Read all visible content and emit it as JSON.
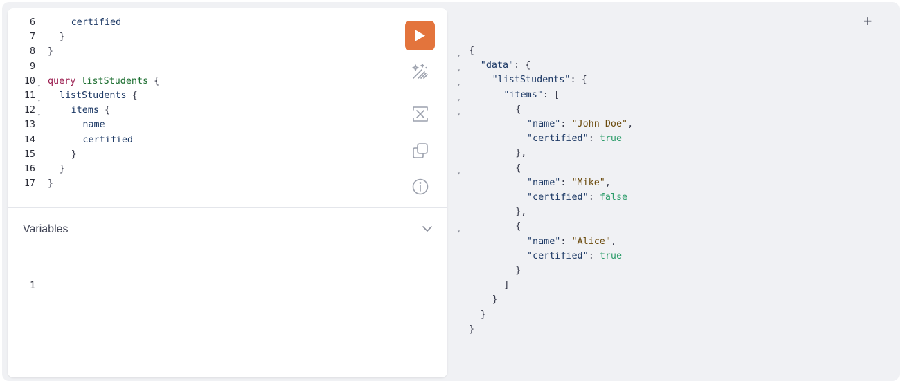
{
  "editor": {
    "lines": [
      {
        "n": "6",
        "tokens": [
          {
            "t": "certified",
            "c": "fld"
          }
        ],
        "indent": 4
      },
      {
        "n": "7",
        "tokens": [
          {
            "t": "}",
            "c": "pun"
          }
        ],
        "indent": 2
      },
      {
        "n": "8",
        "tokens": [
          {
            "t": "}",
            "c": "pun"
          }
        ],
        "indent": 0
      },
      {
        "n": "9",
        "tokens": [],
        "indent": 0
      },
      {
        "n": "10",
        "fold": true,
        "tokens": [
          {
            "t": "query",
            "c": "kw"
          },
          {
            "t": " ",
            "c": "pun"
          },
          {
            "t": "listStudents",
            "c": "def"
          },
          {
            "t": " {",
            "c": "pun"
          }
        ],
        "indent": 0
      },
      {
        "n": "11",
        "fold": true,
        "tokens": [
          {
            "t": "listStudents",
            "c": "fld"
          },
          {
            "t": " {",
            "c": "pun"
          }
        ],
        "indent": 2
      },
      {
        "n": "12",
        "fold": true,
        "tokens": [
          {
            "t": "items",
            "c": "fld"
          },
          {
            "t": " {",
            "c": "pun"
          }
        ],
        "indent": 4
      },
      {
        "n": "13",
        "tokens": [
          {
            "t": "name",
            "c": "fld"
          }
        ],
        "indent": 6
      },
      {
        "n": "14",
        "tokens": [
          {
            "t": "certified",
            "c": "fld"
          }
        ],
        "indent": 6
      },
      {
        "n": "15",
        "tokens": [
          {
            "t": "}",
            "c": "pun"
          }
        ],
        "indent": 4
      },
      {
        "n": "16",
        "tokens": [
          {
            "t": "}",
            "c": "pun"
          }
        ],
        "indent": 2
      },
      {
        "n": "17",
        "tokens": [
          {
            "t": "}",
            "c": "pun"
          }
        ],
        "indent": 0
      }
    ]
  },
  "toolbar": {
    "run_icon": "play-icon",
    "prettify_icon": "magic-wand-icon",
    "merge_icon": "merge-fragments-icon",
    "copy_icon": "copy-icon",
    "info_icon": "info-icon"
  },
  "variables": {
    "title": "Variables",
    "line_number": "1"
  },
  "tabs": {
    "add_label": "+"
  },
  "result": {
    "lines": [
      {
        "fold": true,
        "indent": 0,
        "tokens": [
          {
            "t": "{",
            "c": "pun"
          }
        ]
      },
      {
        "fold": true,
        "indent": 2,
        "tokens": [
          {
            "t": "\"data\"",
            "c": "key"
          },
          {
            "t": ": {",
            "c": "pun"
          }
        ]
      },
      {
        "fold": true,
        "indent": 4,
        "tokens": [
          {
            "t": "\"listStudents\"",
            "c": "key"
          },
          {
            "t": ": {",
            "c": "pun"
          }
        ]
      },
      {
        "fold": true,
        "indent": 6,
        "tokens": [
          {
            "t": "\"items\"",
            "c": "key"
          },
          {
            "t": ": [",
            "c": "pun"
          }
        ]
      },
      {
        "fold": true,
        "indent": 8,
        "tokens": [
          {
            "t": "{",
            "c": "pun"
          }
        ]
      },
      {
        "indent": 10,
        "tokens": [
          {
            "t": "\"name\"",
            "c": "key"
          },
          {
            "t": ": ",
            "c": "pun"
          },
          {
            "t": "\"John Doe\"",
            "c": "str"
          },
          {
            "t": ",",
            "c": "pun"
          }
        ]
      },
      {
        "indent": 10,
        "tokens": [
          {
            "t": "\"certified\"",
            "c": "key"
          },
          {
            "t": ": ",
            "c": "pun"
          },
          {
            "t": "true",
            "c": "bool"
          }
        ]
      },
      {
        "indent": 8,
        "tokens": [
          {
            "t": "},",
            "c": "pun"
          }
        ]
      },
      {
        "fold": true,
        "indent": 8,
        "tokens": [
          {
            "t": "{",
            "c": "pun"
          }
        ]
      },
      {
        "indent": 10,
        "tokens": [
          {
            "t": "\"name\"",
            "c": "key"
          },
          {
            "t": ": ",
            "c": "pun"
          },
          {
            "t": "\"Mike\"",
            "c": "str"
          },
          {
            "t": ",",
            "c": "pun"
          }
        ]
      },
      {
        "indent": 10,
        "tokens": [
          {
            "t": "\"certified\"",
            "c": "key"
          },
          {
            "t": ": ",
            "c": "pun"
          },
          {
            "t": "false",
            "c": "bool"
          }
        ]
      },
      {
        "indent": 8,
        "tokens": [
          {
            "t": "},",
            "c": "pun"
          }
        ]
      },
      {
        "fold": true,
        "indent": 8,
        "tokens": [
          {
            "t": "{",
            "c": "pun"
          }
        ]
      },
      {
        "indent": 10,
        "tokens": [
          {
            "t": "\"name\"",
            "c": "key"
          },
          {
            "t": ": ",
            "c": "pun"
          },
          {
            "t": "\"Alice\"",
            "c": "str"
          },
          {
            "t": ",",
            "c": "pun"
          }
        ]
      },
      {
        "indent": 10,
        "tokens": [
          {
            "t": "\"certified\"",
            "c": "key"
          },
          {
            "t": ": ",
            "c": "pun"
          },
          {
            "t": "true",
            "c": "bool"
          }
        ]
      },
      {
        "indent": 8,
        "tokens": [
          {
            "t": "}",
            "c": "pun"
          }
        ]
      },
      {
        "indent": 6,
        "tokens": [
          {
            "t": "]",
            "c": "pun"
          }
        ]
      },
      {
        "indent": 4,
        "tokens": [
          {
            "t": "}",
            "c": "pun"
          }
        ]
      },
      {
        "indent": 2,
        "tokens": [
          {
            "t": "}",
            "c": "pun"
          }
        ]
      },
      {
        "indent": 0,
        "tokens": [
          {
            "t": "}",
            "c": "pun"
          }
        ]
      }
    ]
  }
}
